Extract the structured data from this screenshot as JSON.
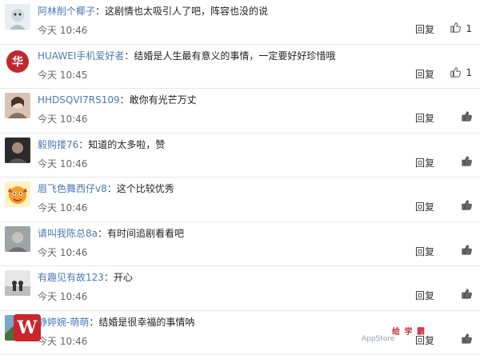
{
  "comments": [
    {
      "user": "阿林削个椰子",
      "text": "这剧情也太吸引人了吧，阵容也没的说",
      "time": "今天 10:46",
      "reply": "回复",
      "likes": "1",
      "liked": true,
      "avatar": "snow-avatar"
    },
    {
      "user": "HUAWEI手机爱好者",
      "text": "结婚是人生最有意义的事情，一定要好好珍惜哦",
      "time": "今天 10:45",
      "reply": "回复",
      "likes": "1",
      "liked": true,
      "avatar": "hua-avatar",
      "avatar_char": "华"
    },
    {
      "user": "HHDSQVI7RS109",
      "text": "敢你有光芒万丈",
      "time": "今天 10:46",
      "reply": "回复",
      "likes": "",
      "liked": false,
      "avatar": "photo-avatar"
    },
    {
      "user": "毅购搂76",
      "text": "知道的太多啦，赞",
      "time": "今天 10:46",
      "reply": "回复",
      "likes": "",
      "liked": false,
      "avatar": "dark-photo-avatar"
    },
    {
      "user": "眉飞色舞西仔v8",
      "text": "这个比较优秀",
      "time": "今天 10:46",
      "reply": "回复",
      "likes": "",
      "liked": false,
      "avatar": "cartoon-avatar"
    },
    {
      "user": "请叫我陈总8a",
      "text": "有时间追剧看看吧",
      "time": "今天 10:46",
      "reply": "回复",
      "likes": "",
      "liked": false,
      "avatar": "grey-photo-avatar"
    },
    {
      "user": "有趣见有故123",
      "text": "开心",
      "time": "今天 10:46",
      "reply": "回复",
      "likes": "",
      "liked": false,
      "avatar": "silhouette-avatar"
    },
    {
      "user": "静婷婉-萌萌",
      "text": "结婚是很幸福的事情呐",
      "time": "今天 10:46",
      "reply": "回复",
      "likes": "",
      "liked": false,
      "avatar": "scenery-avatar"
    }
  ],
  "separator": "：",
  "logo_letter": "W",
  "watermark": {
    "brand": "给 学 霸",
    "sub": "AppStore"
  },
  "colors": {
    "username": "#4a7ab4",
    "logo_bg": "#c9252b",
    "watermark": "#c4303a"
  }
}
